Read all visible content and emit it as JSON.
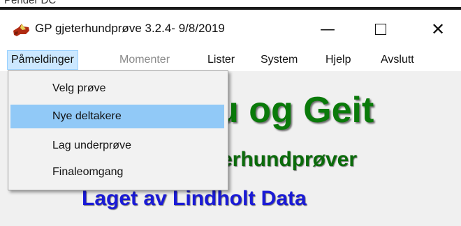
{
  "background_window": {
    "title_fragment": "Pender DC"
  },
  "window": {
    "title": "GP gjeterhundprøve 3.2.4- 9/8/2019",
    "controls": {
      "minimize": "—",
      "close": "✕"
    }
  },
  "menubar": {
    "items": [
      {
        "label": "Påmeldinger",
        "state": "active"
      },
      {
        "label": "Momenter",
        "state": "disabled"
      },
      {
        "label": "Lister",
        "state": "normal"
      },
      {
        "label": "System",
        "state": "normal"
      },
      {
        "label": "Hjelp",
        "state": "normal"
      },
      {
        "label": "Avslutt",
        "state": "normal"
      }
    ]
  },
  "dropdown": {
    "items": [
      {
        "label": "Velg prøve",
        "highlighted": false
      },
      {
        "label": "Nye deltakere",
        "highlighted": true
      },
      {
        "label": "Lag underprøve",
        "highlighted": false
      },
      {
        "label": "Finaleomgang",
        "highlighted": false
      }
    ]
  },
  "banner": {
    "line1": "u og Geit",
    "line2": "erhundprøver",
    "line3": "Laget av Lindholt Data",
    "colors": {
      "green": "#0a7a0a",
      "blue": "#1a1ad6"
    }
  },
  "colors": {
    "menu_active": "#cce8ff",
    "dropdown_highlight": "#91c9f7"
  }
}
